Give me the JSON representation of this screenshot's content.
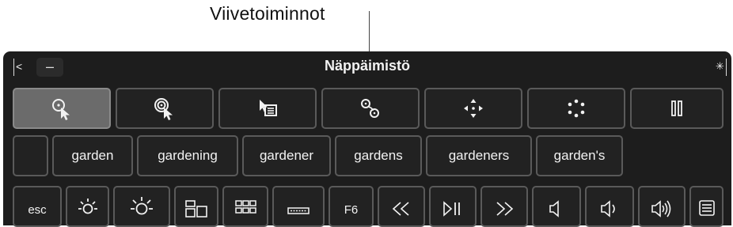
{
  "callout": {
    "label": "Viivetoiminnot"
  },
  "window": {
    "title": "Näppäimistö",
    "close_glyph": "<",
    "minimize_glyph": "–",
    "options_glyph": "✳"
  },
  "dwell_toolbar": {
    "items": [
      {
        "name": "left-click-icon",
        "active": true
      },
      {
        "name": "double-click-icon",
        "active": false
      },
      {
        "name": "right-click-menu-icon",
        "active": false
      },
      {
        "name": "drag-and-drop-icon",
        "active": false
      },
      {
        "name": "scroll-menu-icon",
        "active": false
      },
      {
        "name": "reposition-icon",
        "active": false
      },
      {
        "name": "pause-icon",
        "active": false
      }
    ]
  },
  "suggestions": {
    "words": [
      "garden",
      "gardening",
      "gardener",
      "gardens",
      "gardeners",
      "garden's"
    ]
  },
  "function_row": {
    "esc": "esc",
    "f6": "F6",
    "icons": [
      "brightness-down-icon",
      "brightness-up-icon",
      "mission-control-icon",
      "launchpad-icon",
      "keyboard-backlight-icon",
      "rewind-icon",
      "play-pause-icon",
      "fast-forward-icon",
      "mute-icon",
      "volume-down-icon",
      "volume-up-icon",
      "list-icon"
    ]
  },
  "colors": {
    "panel": "#1d1d1d",
    "key_border": "#5a5a5a",
    "key_active": "#6b6b6b",
    "text": "#f2f2f2"
  }
}
